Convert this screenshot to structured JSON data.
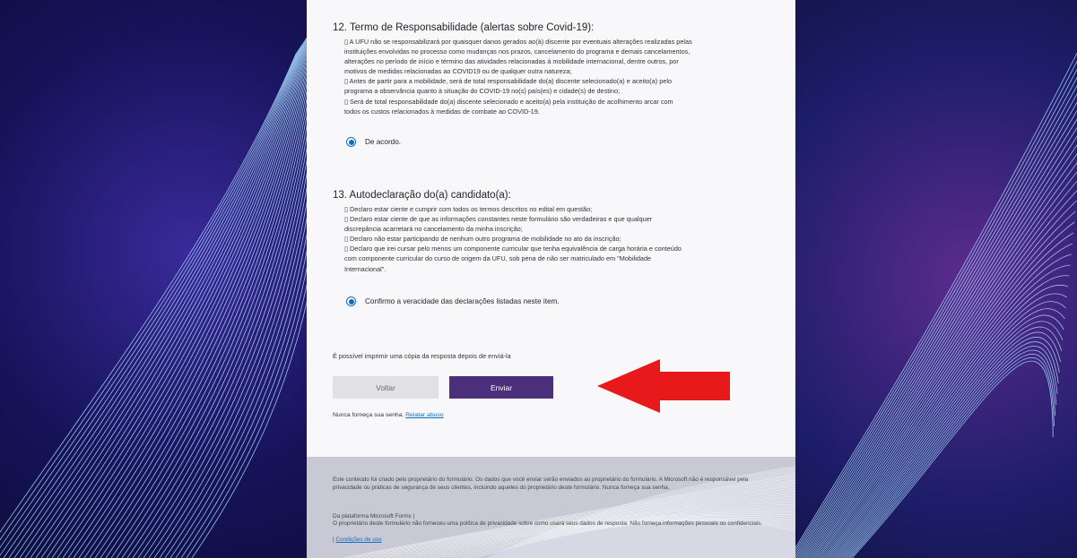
{
  "q12": {
    "title": "12. Termo de Responsabilidade (alertas sobre Covid-19):",
    "body": "▯ A UFU não se responsabilizará por quaisquer danos gerados ao(à) discente por eventuais alterações realizadas pelas\ninstituições envolvidas no processo como mudanças nos prazos, cancelamento do programa e demais cancelamentos,\nalterações no período de início e término das atividades relacionadas à mobilidade internacional, dentre outros, por\nmotivos de medidas relacionadas ao COVID19 ou de qualquer outra natureza;\n▯ Antes de partir para a mobilidade, será de total responsabilidade do(a) discente selecionado(a) e aceito(a) pelo\nprograma a observância quanto à situação do COVID-19 no(s) país(es) e cidade(s) de destino;\n▯ Será de total responsabilidade do(a) discente selecionado e aceito(a) pela instituição de acolhimento arcar com\ntodos os custos relacionados à medidas de combate ao COVID-19.",
    "option": "De acordo."
  },
  "q13": {
    "title": "13. Autodeclaração do(a) candidato(a):",
    "body": "▯ Declaro estar ciente e cumprir com todos os termos descritos no edital em questão;\n▯ Declaro estar ciente de que as informações constantes neste formulário são verdadeiras e que qualquer\ndiscrepância acarretará no cancelamento da minha inscrição;\n▯ Declaro não estar participando de nenhum outro programa de mobilidade no ato da inscrição;\n▯ Declaro que irei cursar pelo menos um componente curricular que tenha equivalência de carga horária e conteúdo\ncom componente curricular do curso de origem da UFU, sob pena de não ser matriculado em \"Mobilidade\nInternacional\".",
    "option": "Confirmo a veracidade das declarações listadas neste item."
  },
  "print_note": "É possível imprimir uma cópia da resposta depois de enviá-la",
  "buttons": {
    "back": "Voltar",
    "send": "Enviar"
  },
  "password_note": "Nunca forneça sua senha.",
  "report_link": "Relatar abuso",
  "footer": {
    "disclaimer": "Este conteúdo foi criado pelo proprietário do formulário. Os dados que você enviar serão enviados ao proprietário do formulário. A Microsoft não é responsável pela privacidade ou práticas de segurança de seus clientes, incluindo aqueles do proprietário deste formulário. Nunca forneça sua senha.",
    "platform": "Da plataforma Microsoft Forms |",
    "privacy": "O proprietário deste formulário não forneceu uma política de privacidade sobre como usará seus dados de resposta. Não forneça informações pessoais ou confidenciais.",
    "terms_prefix": "| ",
    "terms_link": "Condições de uso"
  },
  "colors": {
    "accent": "#0f6cbd",
    "send_button": "#4b2f7b",
    "arrow": "#e8191a"
  }
}
